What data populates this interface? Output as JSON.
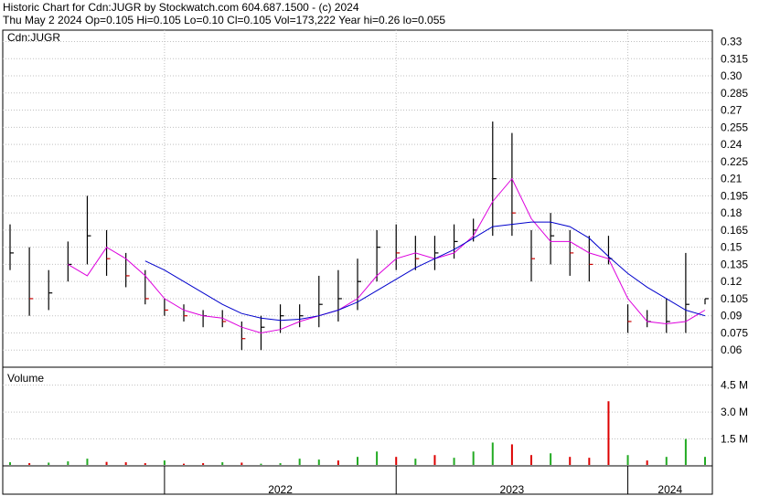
{
  "header": {
    "line1": "Historic Chart for Cdn:JUGR by Stockwatch.com 604.687.1500 - (c) 2024",
    "line2": "Thu May  2 2024   Op=0.105   Hi=0.105   Lo=0.10   Cl=0.105   Vol=173,222   Year hi=0.26   lo=0.055"
  },
  "colors": {
    "price_bar": "#000000",
    "down_tick": "#cc0000",
    "ma_short": "#dd00dd",
    "ma_long": "#0000cc",
    "vol_up": "#22aa22",
    "vol_down": "#dd0000",
    "grid": "#c0c0c0"
  },
  "chart_data": [
    {
      "type": "line",
      "title": "Cdn:JUGR",
      "y_scale": "linear",
      "ylim": [
        0.045,
        0.34
      ],
      "y_ticks": [
        "0.33",
        "0.315",
        "0.30",
        "0.285",
        "0.27",
        "0.255",
        "0.24",
        "0.225",
        "0.21",
        "0.195",
        "0.18",
        "0.165",
        "0.15",
        "0.135",
        "0.12",
        "0.105",
        "0.09",
        "0.075",
        "0.06"
      ],
      "grid": true,
      "x_range": [
        "2021-05",
        "2024-05"
      ],
      "x_ticks": [
        {
          "label": "2022",
          "date": "2022-01"
        },
        {
          "label": "2023",
          "date": "2023-01"
        },
        {
          "label": "2024",
          "date": "2024-01"
        }
      ],
      "series": [
        {
          "kind": "hlc_bars",
          "points": [
            [
              "2021-05",
              0.13,
              0.17,
              0.145
            ],
            [
              "2021-06",
              0.09,
              0.15,
              0.105
            ],
            [
              "2021-07",
              0.095,
              0.13,
              0.11
            ],
            [
              "2021-08",
              0.12,
              0.155,
              0.135
            ],
            [
              "2021-09",
              0.135,
              0.195,
              0.16
            ],
            [
              "2021-10",
              0.125,
              0.165,
              0.14
            ],
            [
              "2021-11",
              0.115,
              0.145,
              0.125
            ],
            [
              "2021-12",
              0.1,
              0.13,
              0.105
            ],
            [
              "2022-01",
              0.09,
              0.105,
              0.095
            ],
            [
              "2022-02",
              0.085,
              0.1,
              0.09
            ],
            [
              "2022-03",
              0.08,
              0.095,
              0.09
            ],
            [
              "2022-04",
              0.08,
              0.095,
              0.085
            ],
            [
              "2022-05",
              0.06,
              0.085,
              0.07
            ],
            [
              "2022-06",
              0.06,
              0.09,
              0.08
            ],
            [
              "2022-07",
              0.075,
              0.1,
              0.09
            ],
            [
              "2022-08",
              0.08,
              0.1,
              0.09
            ],
            [
              "2022-09",
              0.08,
              0.125,
              0.1
            ],
            [
              "2022-10",
              0.085,
              0.13,
              0.105
            ],
            [
              "2022-11",
              0.095,
              0.14,
              0.12
            ],
            [
              "2022-12",
              0.12,
              0.165,
              0.15
            ],
            [
              "2023-01",
              0.13,
              0.17,
              0.145
            ],
            [
              "2023-02",
              0.13,
              0.16,
              0.14
            ],
            [
              "2023-03",
              0.13,
              0.16,
              0.145
            ],
            [
              "2023-04",
              0.14,
              0.17,
              0.155
            ],
            [
              "2023-05",
              0.155,
              0.175,
              0.165
            ],
            [
              "2023-06",
              0.16,
              0.26,
              0.21
            ],
            [
              "2023-07",
              0.16,
              0.25,
              0.18
            ],
            [
              "2023-08",
              0.12,
              0.165,
              0.14
            ],
            [
              "2023-09",
              0.135,
              0.18,
              0.16
            ],
            [
              "2023-10",
              0.125,
              0.165,
              0.145
            ],
            [
              "2023-11",
              0.12,
              0.16,
              0.135
            ],
            [
              "2023-12",
              0.135,
              0.16,
              0.14
            ],
            [
              "2024-01",
              0.075,
              0.1,
              0.085
            ],
            [
              "2024-02",
              0.08,
              0.095,
              0.085
            ],
            [
              "2024-03",
              0.075,
              0.105,
              0.085
            ],
            [
              "2024-04",
              0.075,
              0.145,
              0.1
            ],
            [
              "2024-05",
              0.1,
              0.105,
              0.105
            ]
          ]
        },
        {
          "kind": "moving_average_short",
          "points": [
            [
              "2021-08",
              0.135
            ],
            [
              "2021-09",
              0.125
            ],
            [
              "2021-10",
              0.15
            ],
            [
              "2021-11",
              0.14
            ],
            [
              "2021-12",
              0.125
            ],
            [
              "2022-01",
              0.105
            ],
            [
              "2022-02",
              0.095
            ],
            [
              "2022-03",
              0.09
            ],
            [
              "2022-04",
              0.088
            ],
            [
              "2022-05",
              0.08
            ],
            [
              "2022-06",
              0.075
            ],
            [
              "2022-07",
              0.078
            ],
            [
              "2022-08",
              0.085
            ],
            [
              "2022-09",
              0.09
            ],
            [
              "2022-10",
              0.095
            ],
            [
              "2022-11",
              0.105
            ],
            [
              "2022-12",
              0.125
            ],
            [
              "2023-01",
              0.14
            ],
            [
              "2023-02",
              0.145
            ],
            [
              "2023-03",
              0.14
            ],
            [
              "2023-04",
              0.145
            ],
            [
              "2023-05",
              0.16
            ],
            [
              "2023-06",
              0.19
            ],
            [
              "2023-07",
              0.21
            ],
            [
              "2023-08",
              0.175
            ],
            [
              "2023-09",
              0.155
            ],
            [
              "2023-10",
              0.155
            ],
            [
              "2023-11",
              0.145
            ],
            [
              "2023-12",
              0.14
            ],
            [
              "2024-01",
              0.105
            ],
            [
              "2024-02",
              0.085
            ],
            [
              "2024-03",
              0.083
            ],
            [
              "2024-04",
              0.085
            ],
            [
              "2024-05",
              0.095
            ]
          ]
        },
        {
          "kind": "moving_average_long",
          "points": [
            [
              "2021-12",
              0.138
            ],
            [
              "2022-01",
              0.13
            ],
            [
              "2022-02",
              0.12
            ],
            [
              "2022-03",
              0.11
            ],
            [
              "2022-04",
              0.1
            ],
            [
              "2022-05",
              0.092
            ],
            [
              "2022-06",
              0.088
            ],
            [
              "2022-07",
              0.086
            ],
            [
              "2022-08",
              0.087
            ],
            [
              "2022-09",
              0.09
            ],
            [
              "2022-10",
              0.095
            ],
            [
              "2022-11",
              0.102
            ],
            [
              "2022-12",
              0.112
            ],
            [
              "2023-01",
              0.122
            ],
            [
              "2023-02",
              0.132
            ],
            [
              "2023-03",
              0.14
            ],
            [
              "2023-04",
              0.148
            ],
            [
              "2023-05",
              0.158
            ],
            [
              "2023-06",
              0.168
            ],
            [
              "2023-07",
              0.17
            ],
            [
              "2023-08",
              0.172
            ],
            [
              "2023-09",
              0.172
            ],
            [
              "2023-10",
              0.168
            ],
            [
              "2023-11",
              0.158
            ],
            [
              "2023-12",
              0.142
            ],
            [
              "2024-01",
              0.127
            ],
            [
              "2024-02",
              0.115
            ],
            [
              "2024-03",
              0.105
            ],
            [
              "2024-04",
              0.095
            ],
            [
              "2024-05",
              0.09
            ]
          ]
        }
      ]
    },
    {
      "type": "bar",
      "title": "Volume",
      "ylim": [
        0,
        5.5
      ],
      "y_ticks": [
        "4.5 M",
        "3.0 M",
        "1.5 M"
      ],
      "values_unit": "M",
      "x_range": [
        "2021-05",
        "2024-05"
      ],
      "points": [
        [
          "2021-05",
          0.2,
          "up"
        ],
        [
          "2021-06",
          0.15,
          "down"
        ],
        [
          "2021-07",
          0.18,
          "up"
        ],
        [
          "2021-08",
          0.25,
          "up"
        ],
        [
          "2021-09",
          0.4,
          "up"
        ],
        [
          "2021-10",
          0.22,
          "down"
        ],
        [
          "2021-11",
          0.2,
          "down"
        ],
        [
          "2021-12",
          0.15,
          "down"
        ],
        [
          "2022-01",
          0.3,
          "up"
        ],
        [
          "2022-02",
          0.12,
          "down"
        ],
        [
          "2022-03",
          0.15,
          "down"
        ],
        [
          "2022-04",
          0.2,
          "up"
        ],
        [
          "2022-05",
          0.18,
          "down"
        ],
        [
          "2022-06",
          0.12,
          "up"
        ],
        [
          "2022-07",
          0.15,
          "up"
        ],
        [
          "2022-08",
          0.4,
          "up"
        ],
        [
          "2022-09",
          0.35,
          "up"
        ],
        [
          "2022-10",
          0.3,
          "down"
        ],
        [
          "2022-11",
          0.5,
          "up"
        ],
        [
          "2022-12",
          0.8,
          "up"
        ],
        [
          "2023-01",
          0.5,
          "down"
        ],
        [
          "2023-02",
          0.4,
          "up"
        ],
        [
          "2023-03",
          0.6,
          "down"
        ],
        [
          "2023-04",
          0.45,
          "up"
        ],
        [
          "2023-05",
          0.8,
          "up"
        ],
        [
          "2023-06",
          1.3,
          "up"
        ],
        [
          "2023-07",
          1.2,
          "down"
        ],
        [
          "2023-08",
          0.6,
          "down"
        ],
        [
          "2023-09",
          0.7,
          "up"
        ],
        [
          "2023-10",
          0.5,
          "down"
        ],
        [
          "2023-11",
          0.45,
          "down"
        ],
        [
          "2023-12",
          3.6,
          "down"
        ],
        [
          "2024-01",
          0.6,
          "up"
        ],
        [
          "2024-02",
          0.3,
          "down"
        ],
        [
          "2024-03",
          0.5,
          "up"
        ],
        [
          "2024-04",
          1.5,
          "up"
        ],
        [
          "2024-05",
          0.5,
          "up"
        ]
      ]
    }
  ]
}
